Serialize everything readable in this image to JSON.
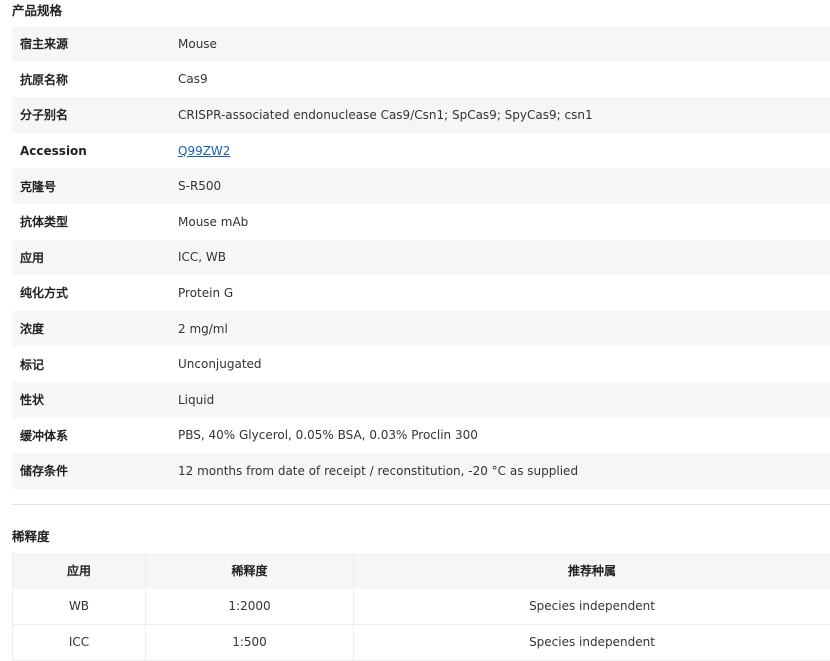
{
  "spec_section": {
    "title": "产品规格",
    "rows": [
      {
        "label": "宿主来源",
        "value": "Mouse"
      },
      {
        "label": "抗原名称",
        "value": "Cas9"
      },
      {
        "label": "分子别名",
        "value": "CRISPR-associated endonuclease Cas9/Csn1; SpCas9; SpyCas9; csn1"
      },
      {
        "label": "Accession",
        "value": "Q99ZW2"
      },
      {
        "label": "克隆号",
        "value": "S-R500"
      },
      {
        "label": "抗体类型",
        "value": "Mouse mAb"
      },
      {
        "label": "应用",
        "value": "ICC, WB"
      },
      {
        "label": "纯化方式",
        "value": "Protein G"
      },
      {
        "label": "浓度",
        "value": "2 mg/ml"
      },
      {
        "label": "标记",
        "value": "Unconjugated"
      },
      {
        "label": "性状",
        "value": "Liquid"
      },
      {
        "label": "缓冲体系",
        "value": "PBS, 40% Glycerol, 0.05% BSA, 0.03% Proclin 300"
      },
      {
        "label": "储存条件",
        "value": "12 months from date of receipt / reconstitution, -20 °C as supplied"
      }
    ]
  },
  "dilution_section": {
    "title": "稀释度",
    "headers": [
      "应用",
      "稀释度",
      "推荐种属"
    ],
    "rows": [
      [
        "WB",
        "1:2000",
        "Species independent"
      ],
      [
        "ICC",
        "1:500",
        "Species independent"
      ]
    ]
  },
  "colors": {
    "link": "#1a5fb4",
    "row_stripe": "#f6f6f6"
  }
}
